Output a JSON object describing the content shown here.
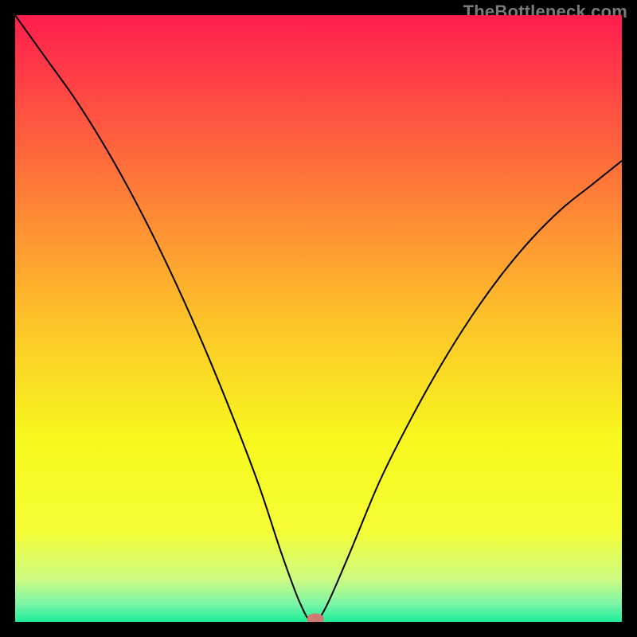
{
  "watermark": "TheBottleneck.com",
  "chart_data": {
    "type": "line",
    "title": "",
    "xlabel": "",
    "ylabel": "",
    "xlim": [
      0,
      100
    ],
    "ylim": [
      0,
      100
    ],
    "background": {
      "type": "vertical-gradient",
      "stops": [
        {
          "offset": 0.0,
          "color": "#ff1d4e"
        },
        {
          "offset": 0.25,
          "color": "#fe6f3a"
        },
        {
          "offset": 0.5,
          "color": "#fdc229"
        },
        {
          "offset": 0.7,
          "color": "#f7f81d"
        },
        {
          "offset": 0.85,
          "color": "#f5fd35"
        },
        {
          "offset": 0.93,
          "color": "#cdfb82"
        },
        {
          "offset": 0.97,
          "color": "#7cf6a7"
        },
        {
          "offset": 1.0,
          "color": "#1cee9a"
        }
      ]
    },
    "curve": {
      "description": "V-shaped bottleneck curve reaching 0 near x≈49",
      "min_x": 49,
      "points": [
        {
          "x": 0,
          "y": 100
        },
        {
          "x": 5,
          "y": 93
        },
        {
          "x": 10,
          "y": 86
        },
        {
          "x": 15,
          "y": 78
        },
        {
          "x": 20,
          "y": 69
        },
        {
          "x": 25,
          "y": 59
        },
        {
          "x": 30,
          "y": 48
        },
        {
          "x": 35,
          "y": 36
        },
        {
          "x": 40,
          "y": 23
        },
        {
          "x": 44,
          "y": 11
        },
        {
          "x": 47,
          "y": 3
        },
        {
          "x": 49,
          "y": 0
        },
        {
          "x": 51,
          "y": 2
        },
        {
          "x": 55,
          "y": 11
        },
        {
          "x": 60,
          "y": 23
        },
        {
          "x": 65,
          "y": 33
        },
        {
          "x": 70,
          "y": 42
        },
        {
          "x": 75,
          "y": 50
        },
        {
          "x": 80,
          "y": 57
        },
        {
          "x": 85,
          "y": 63
        },
        {
          "x": 90,
          "y": 68
        },
        {
          "x": 95,
          "y": 72
        },
        {
          "x": 100,
          "y": 76
        }
      ]
    },
    "marker": {
      "x": 49.5,
      "y": 0.5,
      "rx": 1.4,
      "ry": 0.9,
      "color": "#cf7a72"
    }
  }
}
